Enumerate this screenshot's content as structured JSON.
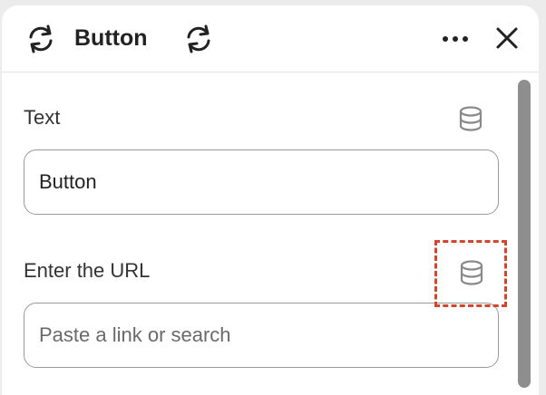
{
  "header": {
    "title": "Button",
    "left_icon": "sync-icon",
    "right_icon": "sync-icon",
    "more_icon": "more-horizontal-icon",
    "close_icon": "close-icon"
  },
  "fields": {
    "text": {
      "label": "Text",
      "value": "Button",
      "icon": "database-icon"
    },
    "url": {
      "label": "Enter the URL",
      "value": "",
      "placeholder": "Paste a link or search",
      "icon": "database-icon"
    }
  },
  "colors": {
    "highlight": "#d0472f",
    "icon": "#8a8a8a",
    "text": "#222222"
  }
}
